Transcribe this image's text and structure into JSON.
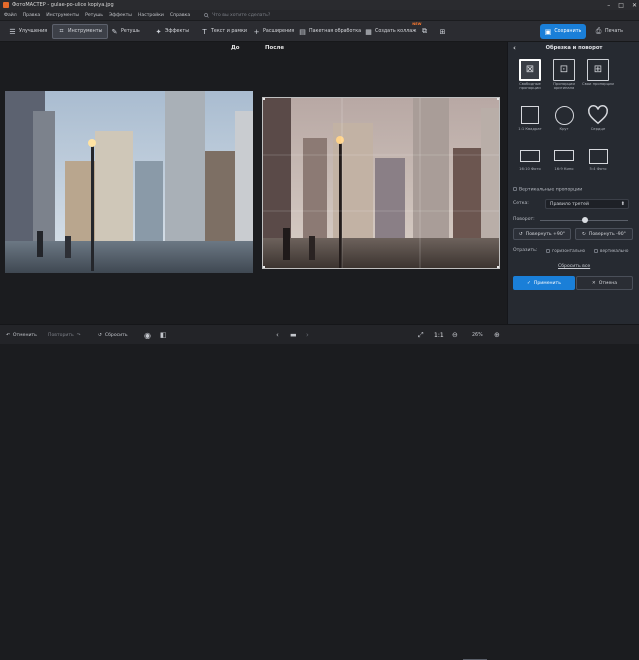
{
  "window": {
    "title": "ФотоМАСТЕР - gulae-po-ulice kopiya.jpg",
    "controls": [
      "minimize-icon",
      "maximize-icon",
      "close-icon"
    ]
  },
  "menu": {
    "items": [
      "Файл",
      "Правка",
      "Инструменты",
      "Ретушь",
      "Эффекты",
      "Настройки",
      "Справка"
    ],
    "search_placeholder": "Что вы хотите сделать?"
  },
  "toolbar": {
    "tabs": [
      {
        "label": "Улучшения",
        "icon": "sliders-icon"
      },
      {
        "label": "Инструменты",
        "icon": "crop-icon",
        "active": true
      },
      {
        "label": "Ретушь",
        "icon": "brush-icon"
      },
      {
        "label": "Эффекты",
        "icon": "sparkle-icon"
      },
      {
        "label": "Текст и рамки",
        "icon": "text-icon"
      },
      {
        "label": "Расширения",
        "icon": "plus-icon"
      },
      {
        "label": "Пакетная обработка",
        "icon": "stack-icon"
      },
      {
        "label": "Создать коллаж",
        "icon": "collage-icon",
        "badge": "NEW"
      }
    ],
    "save_label": "Сохранить",
    "print_label": "Печать"
  },
  "canvas": {
    "before_label": "До",
    "after_label": "После"
  },
  "panel": {
    "title": "Обрезка и поворот",
    "presets": [
      {
        "label": "Свободные пропорции",
        "selected": true
      },
      {
        "label": "Пропорции оригинала"
      },
      {
        "label": "Свои пропорции"
      },
      {
        "label": "1:1 Квадрат"
      },
      {
        "label": "Круг"
      },
      {
        "label": "Сердце"
      },
      {
        "label": "16:10 Фото"
      },
      {
        "label": "16:9 Кино"
      },
      {
        "label": "5:4 Фото"
      }
    ],
    "vertical_proportions": "Вертикальные пропорции",
    "grid_label": "Сетка:",
    "grid_value": "Правило третей",
    "rotate_label": "Поворот:",
    "rotate_ccw": "Повернуть +90°",
    "rotate_cw": "Повернуть -90°",
    "flip_label": "Отразить:",
    "flip_h": "горизонтально",
    "flip_v": "вертикально",
    "reset_all": "Сбросить все",
    "apply": "Применить",
    "cancel": "Отмена"
  },
  "bottom": {
    "undo": "Отменить",
    "redo": "Повторить",
    "reset": "Сбросить",
    "zoom_ratio": "1:1",
    "zoom_percent": "26%"
  },
  "colors": {
    "accent": "#1a7fd8",
    "panel_bg": "#262a31",
    "toolbar_bg": "#2b2c31",
    "new_badge": "#ff7a2e"
  }
}
